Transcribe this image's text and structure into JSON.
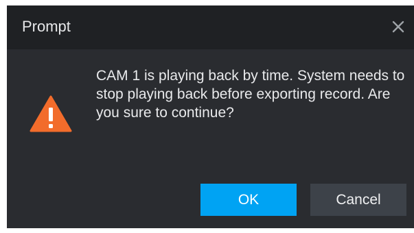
{
  "dialog": {
    "title": "Prompt",
    "message": "CAM 1 is playing back by time. System needs to stop playing back before exporting record. Are you sure to continue?",
    "ok_label": "OK",
    "cancel_label": "Cancel",
    "icons": {
      "close": "close-icon",
      "warning": "warning-icon"
    }
  },
  "colors": {
    "titlebar_bg": "#1f2124",
    "dialog_bg": "#2a2c30",
    "ok_bg": "#00a3f3",
    "cancel_bg": "#3d4249",
    "warning": "#f26c2b"
  }
}
